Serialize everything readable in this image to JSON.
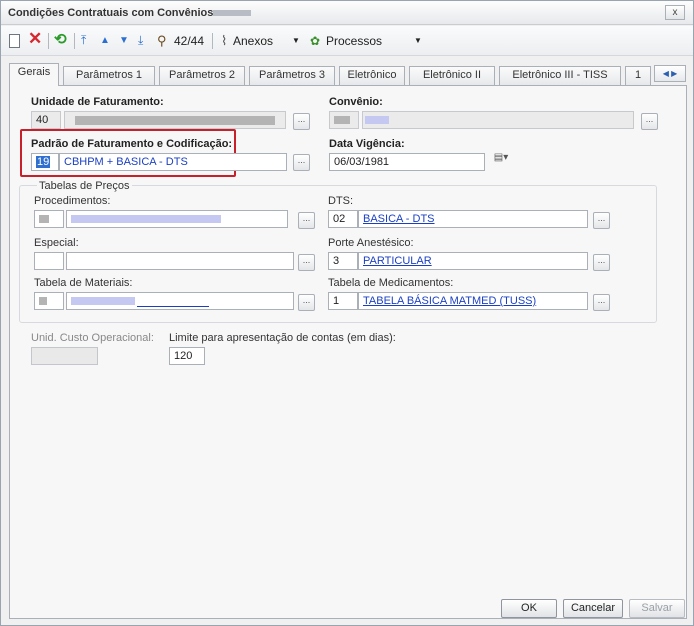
{
  "window": {
    "title": "Condições Contratuais com Convênios:",
    "close": "x"
  },
  "toolbar": {
    "record_position": "42/44",
    "attachments_label": "Anexos",
    "processes_label": "Processos"
  },
  "tabs": [
    "Gerais",
    "Parâmetros 1",
    "Parâmetros 2",
    "Parâmetros 3",
    "Eletrônico",
    "Eletrônico II",
    "Eletrônico III - TISS",
    "1"
  ],
  "form": {
    "unidade_label": "Unidade de Faturamento:",
    "unidade_code": "40",
    "convenio_label": "Convênio:",
    "padrao_label": "Padrão de Faturamento e Codificação:",
    "padrao_code": "19",
    "padrao_value": "CBHPM + BASICA - DTS",
    "vigencia_label": "Data Vigência:",
    "vigencia_value": "06/03/1981",
    "tabelas_title": "Tabelas de Preços",
    "procedimentos_label": "Procedimentos:",
    "dts_label": "DTS:",
    "dts_code": "02",
    "dts_value": "BASICA - DTS",
    "especial_label": "Especial:",
    "porte_label": "Porte Anestésico:",
    "porte_code": "3",
    "porte_value": "PARTICULAR",
    "materiais_label": "Tabela de Materiais:",
    "medicamentos_label": "Tabela de Medicamentos:",
    "medicamentos_code": "1",
    "medicamentos_value": "TABELA BÁSICA MATMED (TUSS)",
    "custo_label": "Unid. Custo Operacional:",
    "limite_label": "Limite para apresentação de contas (em dias):",
    "limite_value": "120",
    "lookup_label": "..."
  },
  "footer": {
    "ok": "OK",
    "cancel": "Cancelar",
    "save": "Salvar"
  }
}
